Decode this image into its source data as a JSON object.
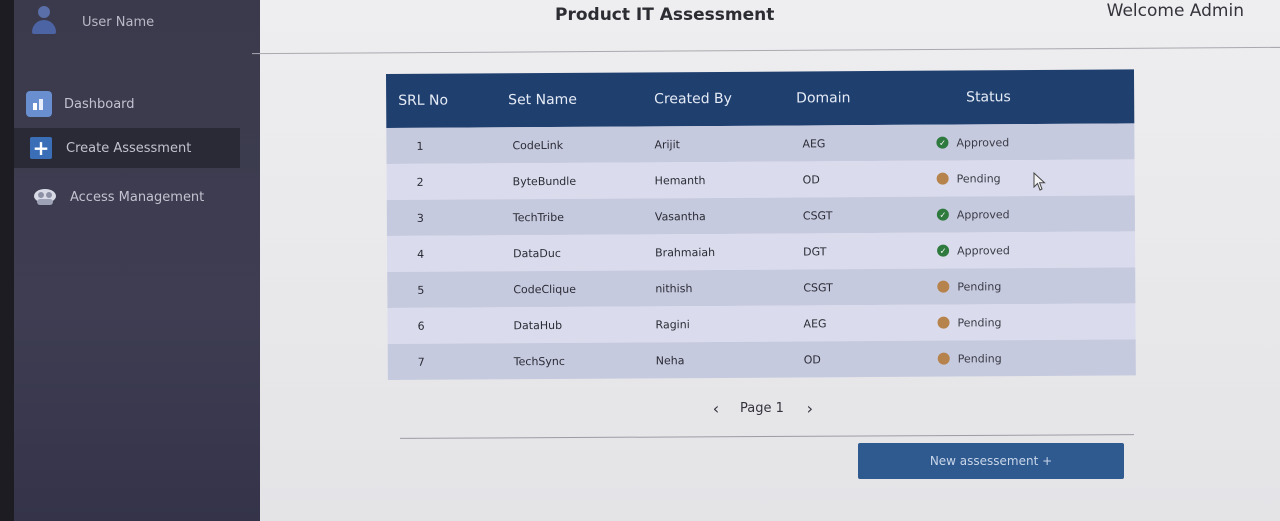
{
  "sidebar": {
    "user_name": "User Name",
    "items": [
      {
        "label": "Dashboard",
        "icon": "dashboard-icon"
      },
      {
        "label": "Create Assessment",
        "icon": "plus-icon"
      },
      {
        "label": "Access Management",
        "icon": "cloud-users-icon"
      }
    ]
  },
  "header": {
    "title": "Product IT Assessment",
    "welcome": "Welcome Admin"
  },
  "table": {
    "columns": [
      "SRL No",
      "Set Name",
      "Created By",
      "Domain",
      "Status"
    ],
    "rows": [
      {
        "srl": "1",
        "set_name": "CodeLink",
        "created_by": "Arijit",
        "domain": "AEG",
        "status": "Approved"
      },
      {
        "srl": "2",
        "set_name": "ByteBundle",
        "created_by": "Hemanth",
        "domain": "OD",
        "status": "Pending"
      },
      {
        "srl": "3",
        "set_name": "TechTribe",
        "created_by": "Vasantha",
        "domain": "CSGT",
        "status": "Approved"
      },
      {
        "srl": "4",
        "set_name": "DataDuc",
        "created_by": "Brahmaiah",
        "domain": "DGT",
        "status": "Approved"
      },
      {
        "srl": "5",
        "set_name": "CodeClique",
        "created_by": "nithish",
        "domain": "CSGT",
        "status": "Pending"
      },
      {
        "srl": "6",
        "set_name": "DataHub",
        "created_by": "Ragini",
        "domain": "AEG",
        "status": "Pending"
      },
      {
        "srl": "7",
        "set_name": "TechSync",
        "created_by": "Neha",
        "domain": "OD",
        "status": "Pending"
      }
    ]
  },
  "pager": {
    "label": "Page 1",
    "prev": "‹",
    "next": "›"
  },
  "actions": {
    "new_assessment": "New assessement +"
  },
  "colors": {
    "header_bg": "#1f3f6f",
    "approved": "#2f7a3e",
    "pending": "#b7834c",
    "button_bg": "#2f5a8f",
    "sidebar_bg": "#3b3a4c"
  }
}
